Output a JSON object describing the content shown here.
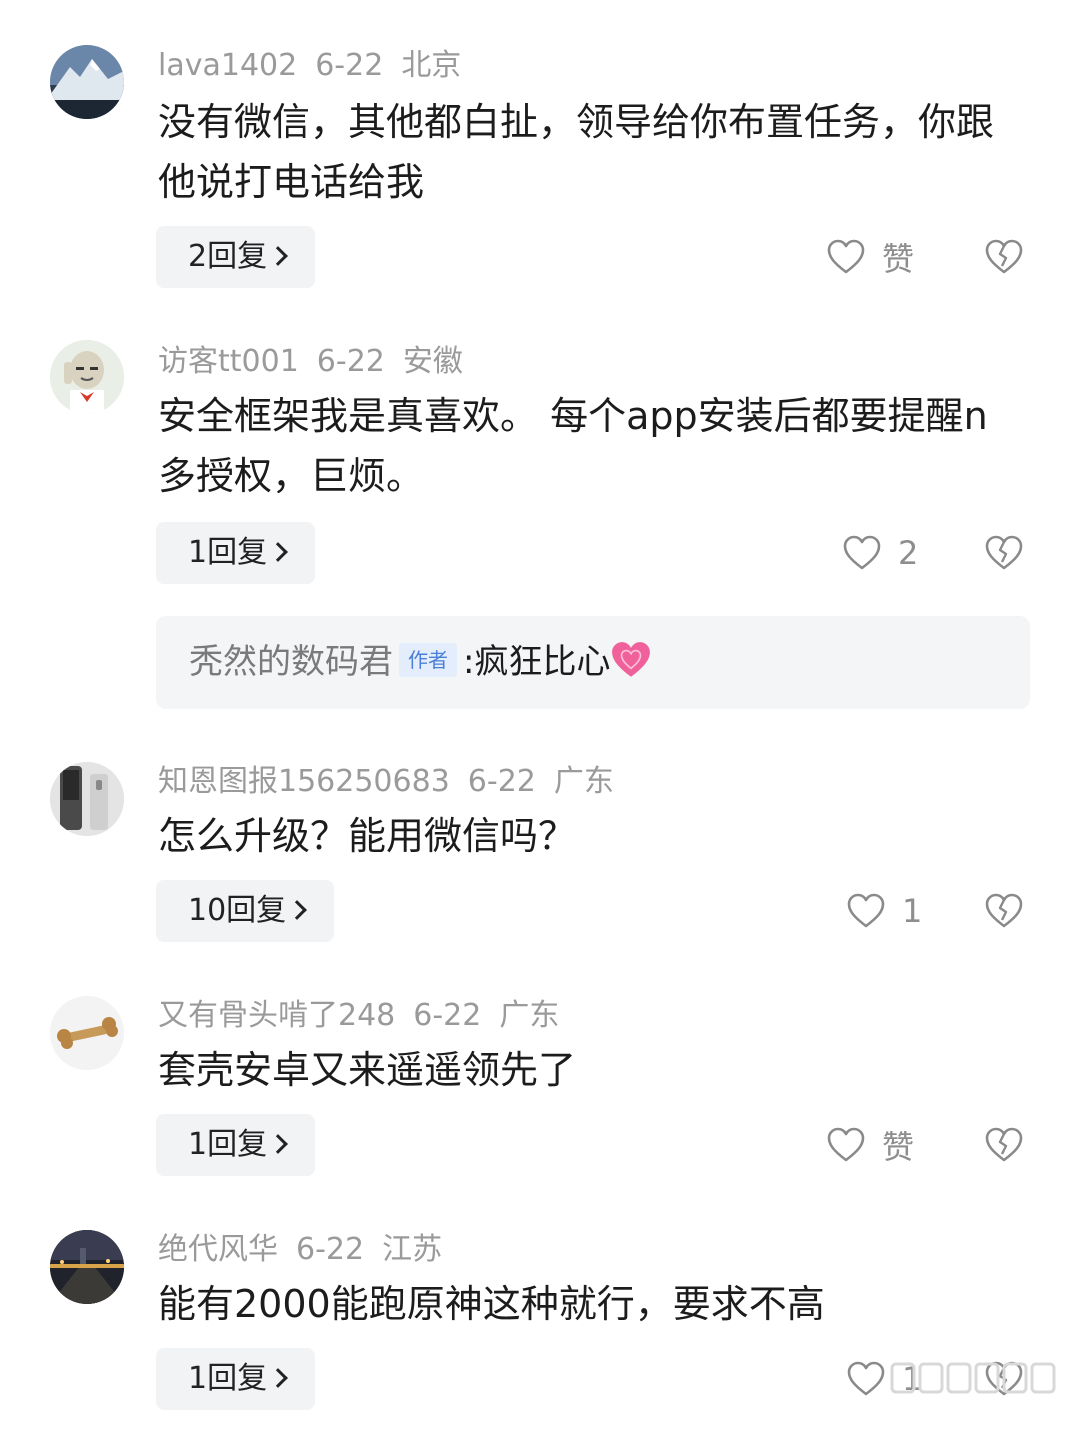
{
  "comments": [
    {
      "username": "lava1402",
      "date": "6-22",
      "location": "北京",
      "text": "没有微信，其他都白扯，领导给你布置任务，你跟他说打电话给我",
      "replies": "2回复",
      "likes": "赞"
    },
    {
      "username": "访客tt001",
      "date": "6-22",
      "location": "安徽",
      "text": "安全框架我是真喜欢。 每个app安装后都要提醒n多授权，巨烦。",
      "replies": "1回复",
      "likes": "2",
      "sub_reply": {
        "username": "秃然的数码君",
        "tag": "作者",
        "separator": ":",
        "text": "疯狂比心"
      }
    },
    {
      "username": "知恩图报156250683",
      "date": "6-22",
      "location": "广东",
      "text": "怎么升级？能用微信吗？",
      "replies": "10回复",
      "likes": "1"
    },
    {
      "username": "又有骨头啃了248",
      "date": "6-22",
      "location": "广东",
      "text": "套壳安卓又来遥遥领先了",
      "replies": "1回复",
      "likes": "赞"
    },
    {
      "username": "绝代风华",
      "date": "6-22",
      "location": "江苏",
      "text": "能有2000能跑原神这种就行，要求不高",
      "replies": "1回复",
      "likes": "1"
    }
  ],
  "icons": {
    "like": "heart-outline-icon",
    "dislike": "broken-heart-icon",
    "reply_arrow": "chevron-right-icon",
    "emoji": "pink-heart-emoji"
  },
  "colors": {
    "meta_text": "#9a9a9a",
    "button_bg": "#f2f3f5",
    "author_tag": "#4a7fd8"
  }
}
